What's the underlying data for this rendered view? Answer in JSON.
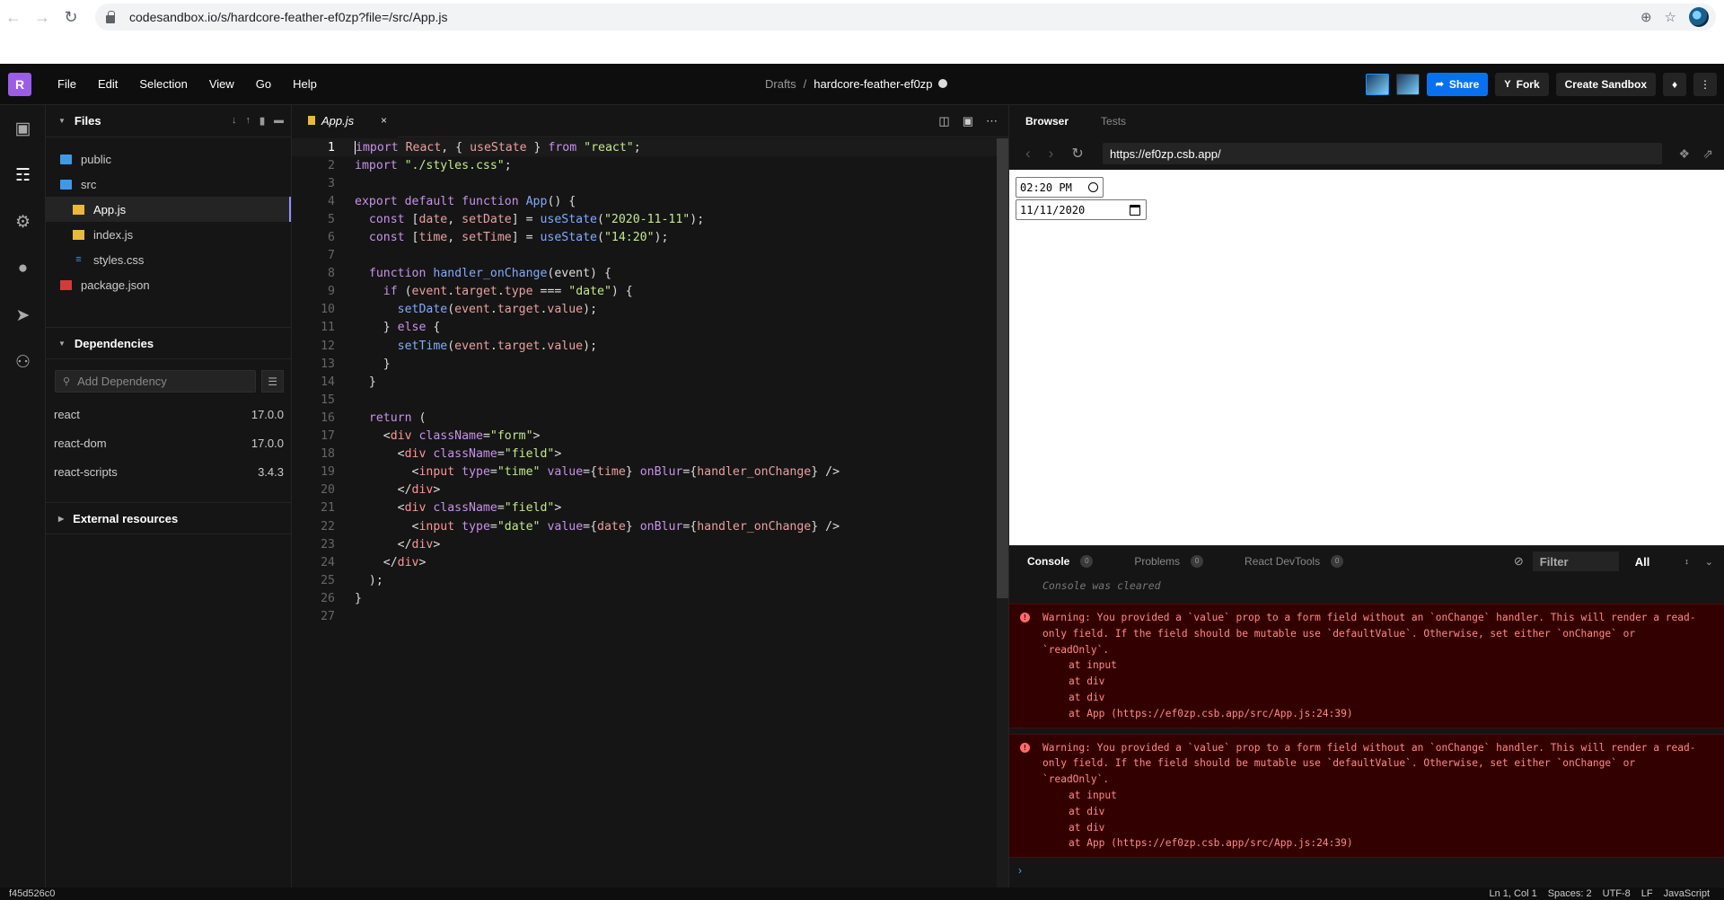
{
  "browser": {
    "url": "codesandbox.io/s/hardcore-feather-ef0zp?file=/src/App.js"
  },
  "menu": [
    "File",
    "Edit",
    "Selection",
    "View",
    "Go",
    "Help"
  ],
  "logo": "R",
  "breadcrumb": {
    "folder": "Drafts",
    "separator": "/",
    "name": "hardcore-feather-ef0zp"
  },
  "toolbar": {
    "share": "Share",
    "fork": "Fork",
    "create": "Create Sandbox"
  },
  "sidebar": {
    "files_title": "Files",
    "tree": [
      {
        "name": "public",
        "type": "folder",
        "indent": 0
      },
      {
        "name": "src",
        "type": "folder",
        "indent": 0
      },
      {
        "name": "App.js",
        "type": "js",
        "indent": 1,
        "active": true
      },
      {
        "name": "index.js",
        "type": "js",
        "indent": 1
      },
      {
        "name": "styles.css",
        "type": "css",
        "indent": 1
      },
      {
        "name": "package.json",
        "type": "pkg",
        "indent": 0
      }
    ],
    "dependencies_title": "Dependencies",
    "add_dependency_placeholder": "Add Dependency",
    "dependencies": [
      {
        "name": "react",
        "version": "17.0.0"
      },
      {
        "name": "react-dom",
        "version": "17.0.0"
      },
      {
        "name": "react-scripts",
        "version": "3.4.3"
      }
    ],
    "external_title": "External resources"
  },
  "editor": {
    "tab_label": "App.js",
    "tab_close": "×",
    "lines": [
      "<span class=\"kw cursor\">import</span> <span class=\"var\">React</span>, { <span class=\"var\">useState</span> } <span class=\"kw\">from</span> <span class=\"str\">\"react\"</span>;",
      "<span class=\"kw\">import</span> <span class=\"str\">\"./styles.css\"</span>;",
      "",
      "<span class=\"kw\">export</span> <span class=\"kw\">default</span> <span class=\"kw\">function</span> <span class=\"fn\">App</span>() {",
      "  <span class=\"kw\">const</span> [<span class=\"var\">date</span>, <span class=\"var\">setDate</span>] = <span class=\"fn\">useState</span>(<span class=\"str\">\"2020-11-11\"</span>);",
      "  <span class=\"kw\">const</span> [<span class=\"var\">time</span>, <span class=\"var\">setTime</span>] = <span class=\"fn\">useState</span>(<span class=\"str\">\"14:20\"</span>);",
      "",
      "  <span class=\"kw\">function</span> <span class=\"fn\">handler_onChange</span>(event) {",
      "    <span class=\"kw\">if</span> (<span class=\"var\">event</span>.<span class=\"var\">target</span>.<span class=\"var\">type</span> === <span class=\"str\">\"date\"</span>) {",
      "      <span class=\"fn\">setDate</span>(<span class=\"var\">event</span>.<span class=\"var\">target</span>.<span class=\"var\">value</span>);",
      "    } <span class=\"kw\">else</span> {",
      "      <span class=\"fn\">setTime</span>(<span class=\"var\">event</span>.<span class=\"var\">target</span>.<span class=\"var\">value</span>);",
      "    }",
      "  }",
      "",
      "  <span class=\"kw\">return</span> (",
      "    &lt;<span class=\"tag\">div</span> <span class=\"attr\">className</span>=<span class=\"str\">\"form\"</span>&gt;",
      "      &lt;<span class=\"tag\">div</span> <span class=\"attr\">className</span>=<span class=\"str\">\"field\"</span>&gt;",
      "        &lt;<span class=\"tag\">input</span> <span class=\"attr\">type</span>=<span class=\"str\">\"time\"</span> <span class=\"attr\">value</span>={<span class=\"var\">time</span>} <span class=\"attr\">onBlur</span>={<span class=\"var\">handler_onChange</span>} /&gt;",
      "      &lt;/<span class=\"tag\">div</span>&gt;",
      "      &lt;<span class=\"tag\">div</span> <span class=\"attr\">className</span>=<span class=\"str\">\"field\"</span>&gt;",
      "        &lt;<span class=\"tag\">input</span> <span class=\"attr\">type</span>=<span class=\"str\">\"date\"</span> <span class=\"attr\">value</span>={<span class=\"var\">date</span>} <span class=\"attr\">onBlur</span>={<span class=\"var\">handler_onChange</span>} /&gt;",
      "      &lt;/<span class=\"tag\">div</span>&gt;",
      "    &lt;/<span class=\"tag\">div</span>&gt;",
      "  );",
      "}",
      ""
    ]
  },
  "preview": {
    "tabs": [
      "Browser",
      "Tests"
    ],
    "url": "https://ef0zp.csb.app/",
    "time_value": "02:20 PM",
    "date_value": "11/11/2020"
  },
  "console": {
    "tabs": [
      {
        "label": "Console",
        "count": "0"
      },
      {
        "label": "Problems",
        "count": "0"
      },
      {
        "label": "React DevTools",
        "count": "0"
      }
    ],
    "filter_placeholder": "Filter",
    "level": "All",
    "cleared": "Console was cleared",
    "warnings": [
      {
        "text": "Warning: You provided a `value` prop to a form field without an `onChange` handler. This will render a read-only field. If the field should be mutable use `defaultValue`. Otherwise, set either `onChange` or `readOnly`.",
        "stack": [
          "at input",
          "at div",
          "at div",
          "at App (https://ef0zp.csb.app/src/App.js:24:39)"
        ]
      },
      {
        "text": "Warning: You provided a `value` prop to a form field without an `onChange` handler. This will render a read-only field. If the field should be mutable use `defaultValue`. Otherwise, set either `onChange` or `readOnly`.",
        "stack": [
          "at input",
          "at div",
          "at div",
          "at App (https://ef0zp.csb.app/src/App.js:24:39)"
        ]
      }
    ]
  },
  "status": {
    "hash": "f45d526c0",
    "position": "Ln 1, Col 1",
    "spaces": "Spaces: 2",
    "encoding": "UTF-8",
    "eol": "LF",
    "language": "JavaScript"
  }
}
